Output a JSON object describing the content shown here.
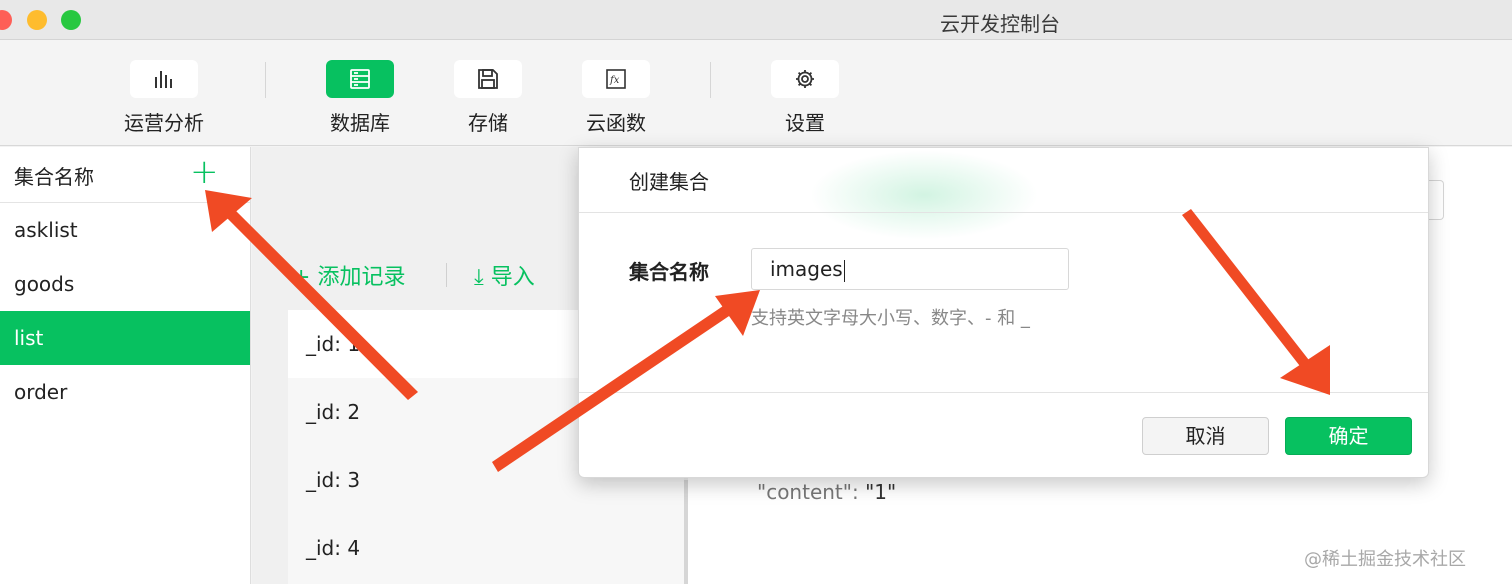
{
  "window": {
    "title": "云开发控制台"
  },
  "toolbar": {
    "items": [
      {
        "label": "运营分析",
        "icon": "bar-chart-icon",
        "active": false
      },
      {
        "label": "数据库",
        "icon": "database-icon",
        "active": true
      },
      {
        "label": "存储",
        "icon": "save-icon",
        "active": false
      },
      {
        "label": "云函数",
        "icon": "function-icon",
        "active": false
      },
      {
        "label": "设置",
        "icon": "gear-icon",
        "active": false
      }
    ]
  },
  "sidebar": {
    "title": "集合名称",
    "add_icon": "+",
    "items": [
      {
        "label": "asklist",
        "active": false
      },
      {
        "label": "goods",
        "active": false
      },
      {
        "label": "list",
        "active": true
      },
      {
        "label": "order",
        "active": false
      }
    ]
  },
  "records": {
    "add_label": "添加记录",
    "import_label": "导入",
    "items": [
      "_id: 1",
      "_id: 2",
      "_id: 3",
      "_id: 4"
    ]
  },
  "detail": {
    "content_key": "\"content\":",
    "content_value": "\"1\""
  },
  "dialog": {
    "title": "创建集合",
    "field_label": "集合名称",
    "field_value": "images",
    "hint": "支持英文字母大小写、数字、- 和 _",
    "cancel_label": "取消",
    "confirm_label": "确定"
  },
  "watermark": "@稀土掘金技术社区",
  "colors": {
    "accent": "#07c160",
    "arrow": "#f04a24"
  }
}
